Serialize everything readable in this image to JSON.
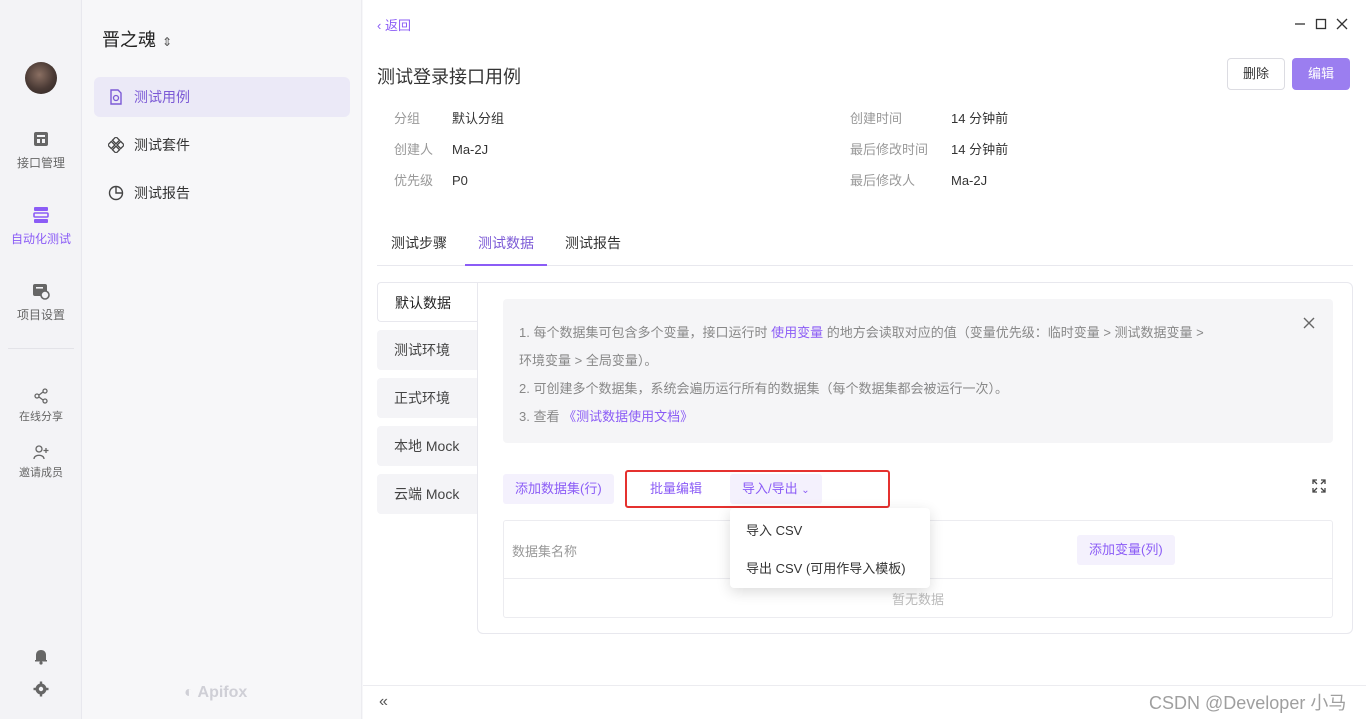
{
  "rail": {
    "items": [
      {
        "label": "接口管理",
        "icon": "api-icon"
      },
      {
        "label": "自动化测试",
        "icon": "automation-icon"
      },
      {
        "label": "项目设置",
        "icon": "settings-icon"
      },
      {
        "label": "在线分享",
        "icon": "share-icon"
      },
      {
        "label": "邀请成员",
        "icon": "invite-icon"
      }
    ]
  },
  "sidebar": {
    "project": "晋之魂",
    "items": [
      {
        "label": "测试用例",
        "icon": "testcase-icon"
      },
      {
        "label": "测试套件",
        "icon": "suite-icon"
      },
      {
        "label": "测试报告",
        "icon": "report-icon"
      }
    ],
    "logo": "Apifox"
  },
  "header": {
    "back": "返回",
    "title": "测试登录接口用例",
    "delete_label": "删除",
    "edit_label": "编辑"
  },
  "meta": {
    "group_k": "分组",
    "group_v": "默认分组",
    "creator_k": "创建人",
    "creator_v": "Ma-2J",
    "priority_k": "优先级",
    "priority_v": "P0",
    "created_k": "创建时间",
    "created_v": "14 分钟前",
    "modified_k": "最后修改时间",
    "modified_v": "14 分钟前",
    "modifier_k": "最后修改人",
    "modifier_v": "Ma-2J"
  },
  "tabs": [
    "测试步骤",
    "测试数据",
    "测试报告"
  ],
  "datasets": [
    "默认数据",
    "测试环境",
    "正式环境",
    "本地 Mock",
    "云端 Mock"
  ],
  "notice": {
    "line1_a": "1. 每个数据集可包含多个变量，接口运行时",
    "line1_link": "使用变量",
    "line1_b": "的地方会读取对应的值（变量优先级：临时变量 > 测试数据变量 >",
    "line1_c": "环境变量 > 全局变量）。",
    "line2": "2. 可创建多个数据集，系统会遍历运行所有的数据集（每个数据集都会被运行一次）。",
    "line3_a": "3. 查看",
    "line3_link": "《测试数据使用文档》"
  },
  "actions": {
    "add_dataset": "添加数据集(行)",
    "batch_edit": "批量编辑",
    "import_export": "导入/导出"
  },
  "table": {
    "col_name": "数据集名称",
    "add_var": "添加变量(列)",
    "empty": "暂无数据"
  },
  "dropdown": {
    "import_csv": "导入 CSV",
    "export_csv": "导出 CSV (可用作导入模板)"
  },
  "footer": {
    "watermark": "CSDN @Developer 小马"
  }
}
